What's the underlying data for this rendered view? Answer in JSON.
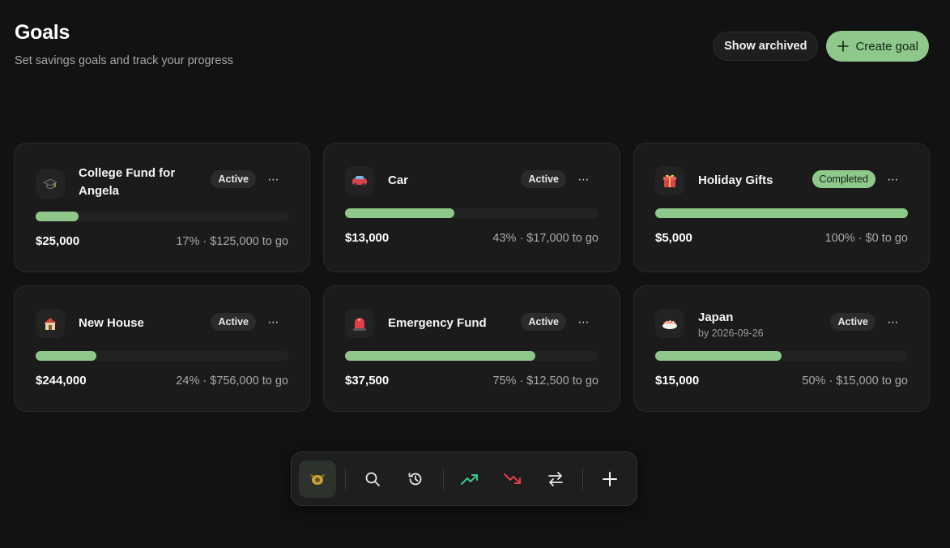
{
  "header": {
    "title": "Goals",
    "subtitle": "Set savings goals and track your progress"
  },
  "actions": {
    "show_archived": "Show archived",
    "create_goal": "Create goal"
  },
  "colors": {
    "accent": "#8ec88a",
    "background": "#121212",
    "card": "#1b1b1b"
  },
  "goals": [
    {
      "icon": "graduation-cap-icon",
      "title": "College Fund for Angela",
      "subtitle": "",
      "status": "Active",
      "progress": 0.17,
      "amount": "$25,000",
      "progress_text": "17% · $125,000 to go"
    },
    {
      "icon": "car-icon",
      "title": "Car",
      "subtitle": "",
      "status": "Active",
      "progress": 0.43,
      "amount": "$13,000",
      "progress_text": "43% · $17,000 to go"
    },
    {
      "icon": "gift-icon",
      "title": "Holiday Gifts",
      "subtitle": "",
      "status": "Completed",
      "progress": 1.0,
      "amount": "$5,000",
      "progress_text": "100% · $0 to go"
    },
    {
      "icon": "house-icon",
      "title": "New House",
      "subtitle": "",
      "status": "Active",
      "progress": 0.24,
      "amount": "$244,000",
      "progress_text": "24% · $756,000 to go"
    },
    {
      "icon": "siren-icon",
      "title": "Emergency Fund",
      "subtitle": "",
      "status": "Active",
      "progress": 0.75,
      "amount": "$37,500",
      "progress_text": "75% · $12,500 to go"
    },
    {
      "icon": "sushi-icon",
      "title": "Japan",
      "subtitle": "by 2026-09-26",
      "status": "Active",
      "progress": 0.5,
      "amount": "$15,000",
      "progress_text": "50% · $15,000 to go"
    }
  ],
  "dock": {
    "items": [
      {
        "icon": "goals-icon",
        "active": true
      },
      {
        "icon": "search-icon",
        "active": false
      },
      {
        "icon": "history-icon",
        "active": false
      },
      {
        "icon": "income-trend-up-icon",
        "active": false,
        "color": "#3cc98a"
      },
      {
        "icon": "expense-trend-down-icon",
        "active": false,
        "color": "#e0404a"
      },
      {
        "icon": "transfer-icon",
        "active": false
      },
      {
        "icon": "add-icon",
        "active": false
      }
    ]
  }
}
